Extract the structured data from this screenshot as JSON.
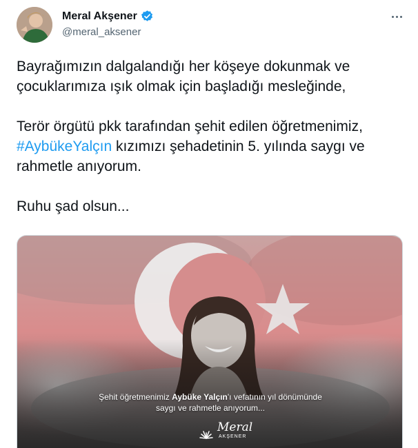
{
  "author": {
    "display_name": "Meral Akşener",
    "handle": "@meral_aksener",
    "verified": true,
    "avatar_icon": "profile-photo"
  },
  "tweet": {
    "para1": "Bayrağımızın dalgalandığı her köşeye dokunmak ve çocuklarımıza ışık olmak için başladığı mesleğinde,",
    "para2_before": "Terör örgütü pkk tarafından şehit edilen öğretmenimiz, ",
    "hashtag": "#AybükeYalçın",
    "para2_after": " kızımızı şehadetinin 5. yılında saygı ve rahmetle anıyorum.",
    "para3": "Ruhu şad olsun..."
  },
  "media": {
    "caption_line1_pre": "Şehit öğretmenimiz ",
    "caption_line1_bold": "Aybüke Yalçın",
    "caption_line1_post": "'ı vefatının yıl dönümünde",
    "caption_line2": "saygı ve rahmetle anıyorum...",
    "logo_text": "Meral",
    "logo_subtext": "AKŞENER"
  },
  "colors": {
    "link": "#1d9bf0",
    "verified": "#1d9bf0",
    "secondary_text": "#536471",
    "flag_red": "#d9878a"
  }
}
